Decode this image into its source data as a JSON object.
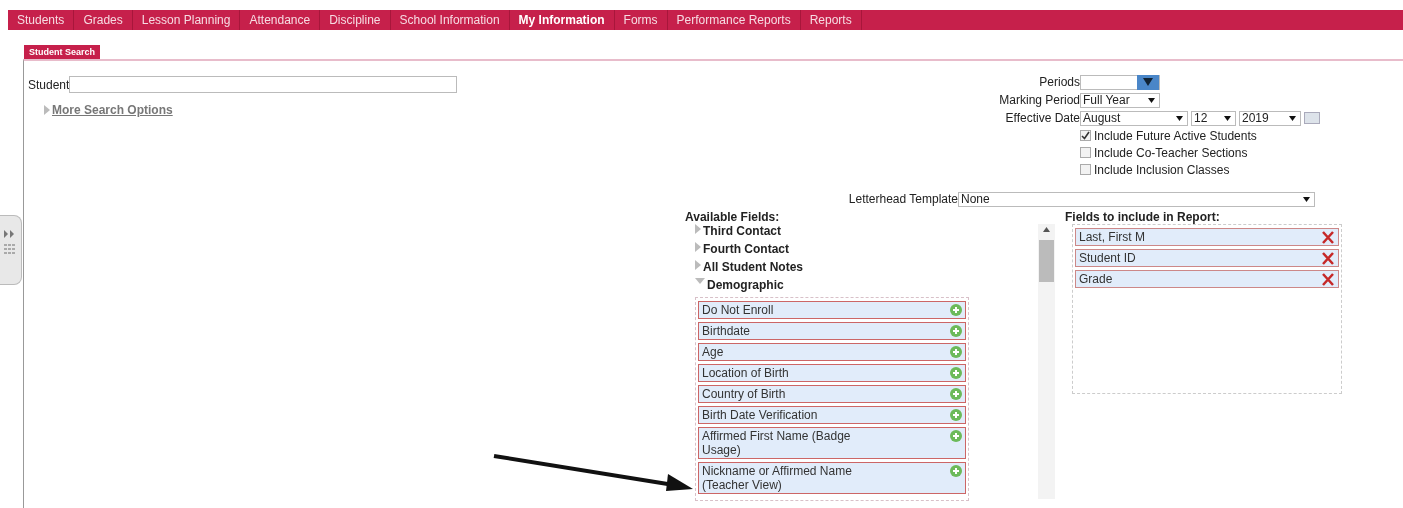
{
  "nav": [
    {
      "label": "Students",
      "selected": false
    },
    {
      "label": "Grades",
      "selected": false
    },
    {
      "label": "Lesson Planning",
      "selected": false
    },
    {
      "label": "Attendance",
      "selected": false
    },
    {
      "label": "Discipline",
      "selected": false
    },
    {
      "label": "School Information",
      "selected": false
    },
    {
      "label": "My Information",
      "selected": true
    },
    {
      "label": "Forms",
      "selected": false
    },
    {
      "label": "Performance Reports",
      "selected": false
    },
    {
      "label": "Reports",
      "selected": false
    }
  ],
  "tabs": [
    {
      "label": "Student Search",
      "selected": true
    }
  ],
  "student_field": {
    "label": "Student"
  },
  "more_search_options": {
    "label": "More Search Options",
    "expanded": false
  },
  "periods": {
    "label": "Periods"
  },
  "marking_period": {
    "label": "Marking Period",
    "value": "Full Year"
  },
  "effective_date": {
    "label": "Effective Date",
    "month": "August",
    "day": "12",
    "year": "2019"
  },
  "options": [
    {
      "label": "Include Future Active Students",
      "checked": true
    },
    {
      "label": "Include Co-Teacher Sections",
      "checked": false
    },
    {
      "label": "Include Inclusion Classes",
      "checked": false
    }
  ],
  "letterhead_template": {
    "label": "Letterhead Template",
    "value": "None"
  },
  "available_fields": {
    "title": "Available Fields:",
    "groups": [
      {
        "label": "Third Contact",
        "expanded": false
      },
      {
        "label": "Fourth Contact",
        "expanded": false
      },
      {
        "label": "All Student Notes",
        "expanded": false
      },
      {
        "label": "Demographic",
        "expanded": true,
        "children": [
          {
            "label": "Do Not Enroll"
          },
          {
            "label": "Birthdate"
          },
          {
            "label": "Age"
          },
          {
            "label": "Location of Birth"
          },
          {
            "label": "Country of Birth"
          },
          {
            "label": "Birth Date Verification"
          },
          {
            "label": "Affirmed First Name (Badge Usage)"
          },
          {
            "label": "Nickname or Affirmed Name (Teacher View)"
          }
        ]
      }
    ]
  },
  "included_fields": {
    "title": "Fields to include in Report:",
    "items": [
      {
        "label": "Last, First M"
      },
      {
        "label": "Student ID"
      },
      {
        "label": "Grade"
      }
    ]
  }
}
